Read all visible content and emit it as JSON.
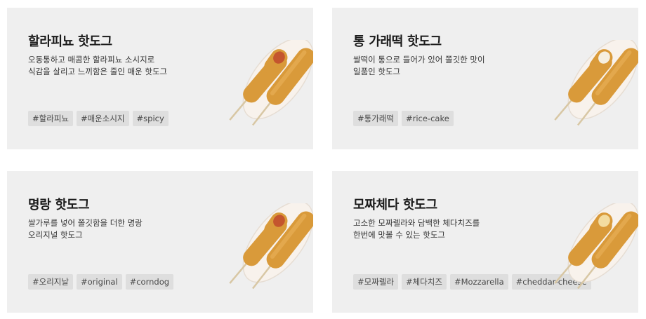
{
  "cards": [
    {
      "title": "할라피뇨 핫도그",
      "desc": [
        "오동통하고 매콤한 할라피뇨 소시지로",
        "식감을 살리고 느끼함은 줄인 매운 핫도그"
      ],
      "tags": [
        "#할라피뇨",
        "#매운소시지",
        "#spicy"
      ],
      "filling": "sausage"
    },
    {
      "title": "통 가래떡 핫도그",
      "desc": [
        "쌀떡이 통으로 들어가 있어 쫄깃한 맛이",
        "일품인 핫도그"
      ],
      "tags": [
        "#통가래떡",
        "#rice-cake"
      ],
      "filling": "ricecake"
    },
    {
      "title": "명랑 핫도그",
      "desc": [
        "쌀가루를 넣어 쫄깃함을 더한 명랑",
        "오리지널 핫도그"
      ],
      "tags": [
        "#오리지날",
        "#original",
        "#corndog"
      ],
      "filling": "sausage"
    },
    {
      "title": "모짜체다 핫도그",
      "desc": [
        "고소한 모짜렐라와 담백한 체다치즈를",
        "한번에 맛볼 수 있는 핫도그"
      ],
      "tags": [
        "#모짜렐라",
        "#체다치즈",
        "#Mozzarella",
        "#cheddar-cheese"
      ],
      "filling": "cheese"
    }
  ],
  "colors": {
    "card_bg": "#efefef",
    "tag_bg": "#dedede",
    "plate": "#f8f2ec",
    "batter": "#d99a3a",
    "sausage": "#c4552e",
    "ricecake": "#f6efe0",
    "cheese": "#f3dca0"
  }
}
